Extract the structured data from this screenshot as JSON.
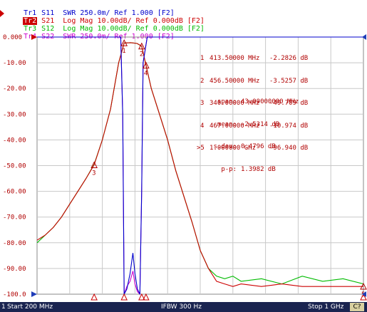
{
  "traces": [
    {
      "tag": "Tr1",
      "text": " S11  SWR 250.0m/ Ref 1.000 [F2]",
      "color": "#0000cc"
    },
    {
      "tag": "Tr2",
      "text": " S21  Log Mag 10.00dB/ Ref 0.000dB [F2]",
      "color": "#cc0000",
      "active": true
    },
    {
      "tag": "Tr3",
      "text": " S12  Log Mag 10.00dB/ Ref 0.000dB [F2]",
      "color": "#00bb00"
    },
    {
      "tag": "Tr4",
      "text": " S22  SWR 250.0m/ Ref 1.000 [F2]",
      "color": "#cc00cc"
    }
  ],
  "y_axis_labels": [
    "0.000",
    "-10.00",
    "-20.00",
    "-30.00",
    "-40.00",
    "-50.00",
    "-60.00",
    "-70.00",
    "-80.00",
    "-90.00",
    "-100.0"
  ],
  "markers": [
    {
      "id": "1",
      "freq": "413.50000 MHz",
      "value": "-2.2826 dB"
    },
    {
      "id": "2",
      "freq": "456.50000 MHz",
      "value": "-3.5257 dB"
    },
    {
      "id": "3",
      "freq": "340.00000 MHz",
      "value": "-49.709 dB"
    },
    {
      "id": "4",
      "freq": "467.00000 MHz",
      "value": "-10.974 dB"
    },
    {
      "id": ">5",
      "freq": "1.000000 GHz",
      "value": "-96.940 dB"
    }
  ],
  "stats": [
    {
      "label": "span:",
      "value": "43.00000000 MHz"
    },
    {
      "label": "mean:",
      "value": "-2.5314 dB"
    },
    {
      "label": "s.dev:",
      "value": "0.4796 dB"
    },
    {
      "label": "p-p:",
      "value": "1.3982 dB"
    }
  ],
  "statusbar": {
    "channel": "1",
    "start": "Start 200 MHz",
    "ifbw": "IFBW 300 Hz",
    "stop": "Stop 1 GHz",
    "badge": "C?"
  },
  "chart_data": {
    "type": "line",
    "x_range_mhz": [
      200,
      1000
    ],
    "ylim": [
      -100,
      0
    ],
    "y_unit": "dB",
    "grid": true,
    "series": [
      {
        "name": "Tr2 S21",
        "color": "#cc0000",
        "x": [
          200,
          220,
          240,
          260,
          280,
          300,
          320,
          340,
          360,
          380,
          400,
          413.5,
          430,
          445,
          456.5,
          467,
          480,
          500,
          520,
          540,
          560,
          580,
          600,
          620,
          640,
          660,
          680,
          700,
          750,
          800,
          850,
          900,
          950,
          1000
        ],
        "y": [
          -79,
          -77,
          -74,
          -70,
          -65,
          -60,
          -55,
          -49.7,
          -40,
          -28,
          -10,
          -2.3,
          -2.2,
          -2.5,
          -3.5,
          -11,
          -20,
          -30,
          -40,
          -52,
          -62,
          -72,
          -83,
          -90,
          -95,
          -96,
          -97,
          -96,
          -97,
          -96,
          -97,
          -97,
          -97,
          -97
        ]
      },
      {
        "name": "Tr3 S12",
        "color": "#00bb00",
        "x": [
          200,
          220,
          240,
          260,
          280,
          300,
          320,
          340,
          360,
          380,
          400,
          413.5,
          430,
          445,
          456.5,
          467,
          480,
          500,
          520,
          540,
          560,
          580,
          600,
          620,
          640,
          660,
          680,
          700,
          750,
          800,
          850,
          900,
          950,
          1000
        ],
        "y": [
          -80,
          -77,
          -74,
          -70,
          -65,
          -60,
          -55,
          -49.5,
          -40,
          -28,
          -10,
          -2.3,
          -2.2,
          -2.5,
          -3.6,
          -11,
          -20,
          -30,
          -40,
          -52,
          -62,
          -72,
          -83,
          -90,
          -93,
          -94,
          -93,
          -95,
          -94,
          -96,
          -93,
          -95,
          -94,
          -96
        ]
      },
      {
        "name": "Tr1 S11",
        "color": "#0000cc",
        "x": [
          200,
          405,
          410,
          413.5,
          420,
          428,
          435,
          440,
          446,
          452,
          456.5,
          460,
          470,
          1000
        ],
        "y": [
          0,
          0,
          -30,
          -100,
          -98,
          -92,
          -84,
          -92,
          -98,
          -100,
          -60,
          -10,
          0,
          0
        ]
      },
      {
        "name": "Tr4 S22",
        "color": "#cc00cc",
        "x": [
          200,
          405,
          410,
          413.5,
          420,
          428,
          435,
          440,
          446,
          452,
          456.5,
          460,
          470,
          1000
        ],
        "y": [
          0,
          0,
          -30,
          -100,
          -97,
          -95,
          -91,
          -96,
          -99,
          -100,
          -60,
          -10,
          0,
          0
        ]
      }
    ],
    "marker_points": [
      {
        "id": "1",
        "x": 413.5,
        "y": -2.2826
      },
      {
        "id": "2",
        "x": 456.5,
        "y": -3.5257
      },
      {
        "id": "3",
        "x": 340.0,
        "y": -49.709
      },
      {
        "id": "4",
        "x": 467.0,
        "y": -10.974
      },
      {
        "id": "5",
        "x": 1000.0,
        "y": -96.94
      }
    ]
  }
}
